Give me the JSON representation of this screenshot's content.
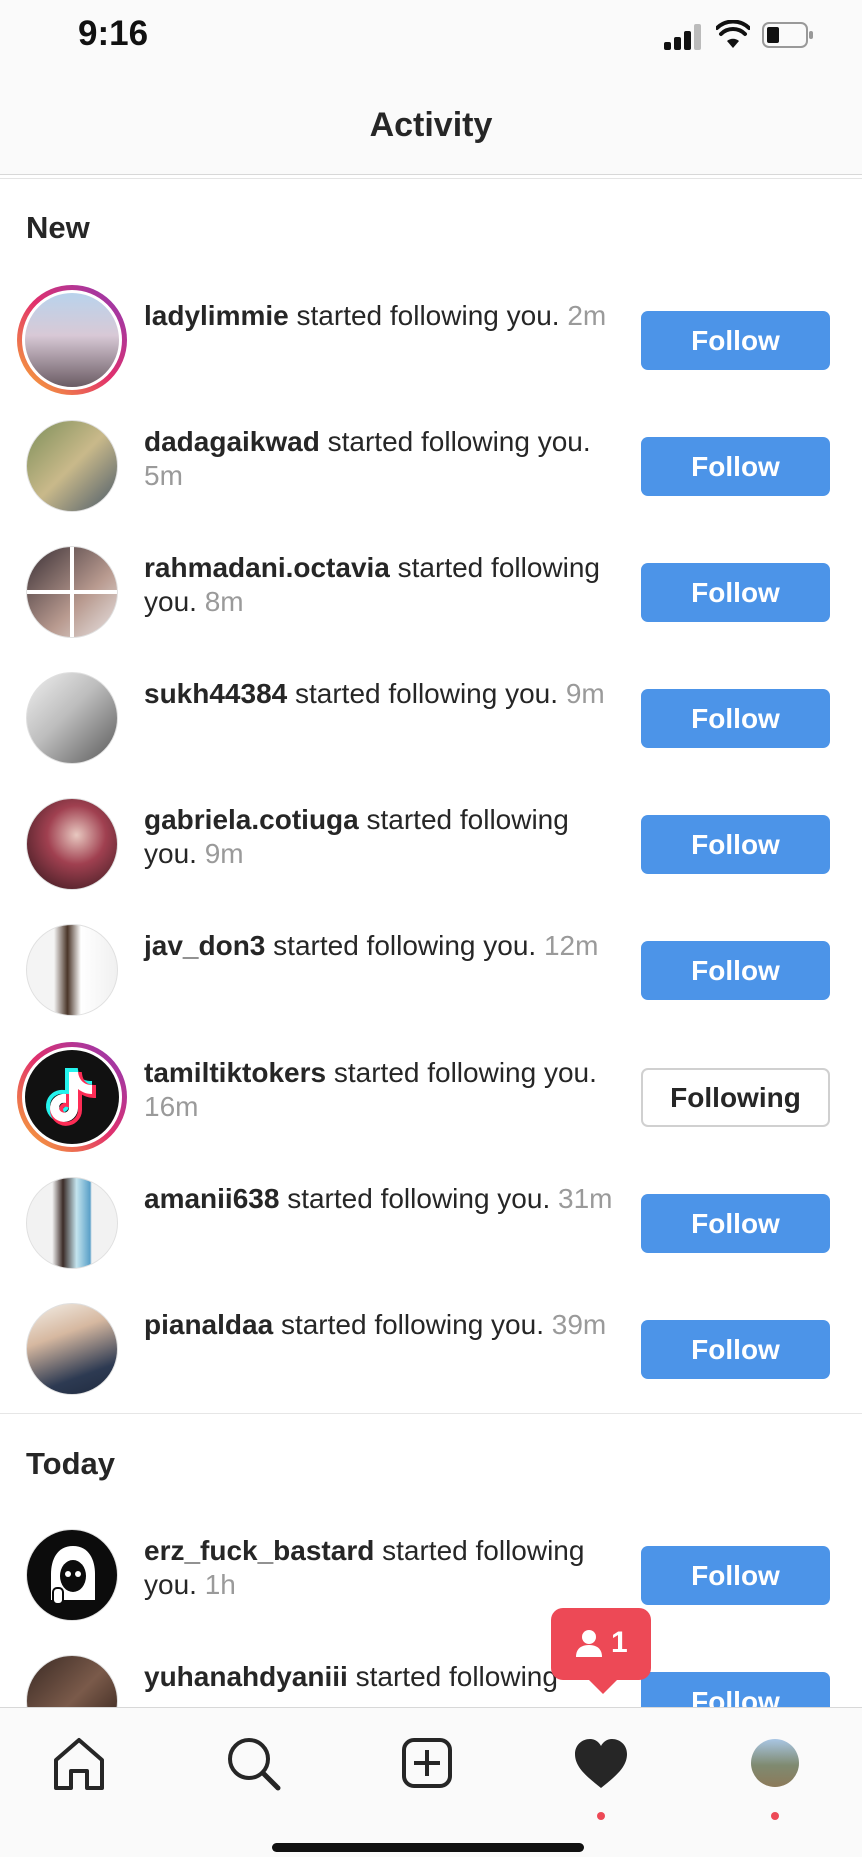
{
  "status_bar": {
    "time": "9:16"
  },
  "header": {
    "title": "Activity"
  },
  "sections": {
    "new_title": "New",
    "today_title": "Today"
  },
  "activity": [
    {
      "username": "ladylimmie",
      "action": " started following you.",
      "time": "2m",
      "button": "Follow"
    },
    {
      "username": "dadagaikwad",
      "action": " started following you.",
      "time": "5m",
      "button": "Follow"
    },
    {
      "username": "rahmadani.octavia",
      "action": " started following you.",
      "time": "8m",
      "button": "Follow"
    },
    {
      "username": "sukh44384",
      "action": " started following you.",
      "time": "9m",
      "button": "Follow"
    },
    {
      "username": "gabriela.cotiuga",
      "action": " started following you.",
      "time": "9m",
      "button": "Follow"
    },
    {
      "username": "jav_don3",
      "action": " started following you.",
      "time": "12m",
      "button": "Follow"
    },
    {
      "username": "tamiltiktokers",
      "action": " started following you.",
      "time": "16m",
      "button": "Following"
    },
    {
      "username": "amanii638",
      "action": " started following you.",
      "time": "31m",
      "button": "Follow"
    },
    {
      "username": "pianaldaa",
      "action": " started following you.",
      "time": "39m",
      "button": "Follow"
    },
    {
      "username": "erz_fuck_bastard",
      "action": " started following you.",
      "time": "1h",
      "button": "Follow"
    },
    {
      "username": "yuhanahdyaniii",
      "action": " started following",
      "time": "",
      "button": "Follow"
    }
  ],
  "notification_badge": {
    "count": "1",
    "icon": "person-icon"
  },
  "tab_bar": {
    "icons": [
      "home-icon",
      "search-icon",
      "new-post-icon",
      "heart-icon",
      "profile-avatar"
    ]
  },
  "colors": {
    "follow_blue": "#4c94e8",
    "badge_red": "#ed4956",
    "text": "#262626",
    "muted": "#9a9a9a"
  }
}
